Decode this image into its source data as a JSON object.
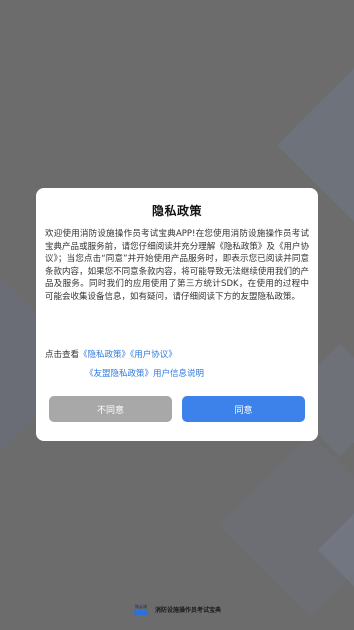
{
  "dialog": {
    "title": "隐私政策",
    "body": "欢迎使用消防设施操作员考试宝典APP!在您使用消防设施操作员考试宝典产品或服务前，请您仔细阅读并充分理解《隐私政策》及《用户协议》；当您点击“同意”并开始使用产品服务时，即表示您已阅读并同意条款内容，如果您不同意条款内容，将可能导致无法继续使用我们的产品及服务。同时我们的应用使用了第三方统计SDK，在使用的过程中可能会收集设备信息，如有疑问，请仔细阅读下方的友盟隐私政策。",
    "links_prefix": "点击查看",
    "privacy_link": "《隐私政策》",
    "agreement_link": "《用户协议》",
    "umeng_link": "《友盟隐私政策》",
    "user_info_link": "用户信息说明",
    "disagree_label": "不同意",
    "agree_label": "同意"
  },
  "footer": {
    "logo_text": "微云课",
    "app_name": "消防设施操作员考试宝典"
  },
  "colors": {
    "overlay": "#6c6c6c",
    "link": "#2f7be0",
    "agree_button": "#3d82ea",
    "disagree_button": "#a8a8a8"
  }
}
